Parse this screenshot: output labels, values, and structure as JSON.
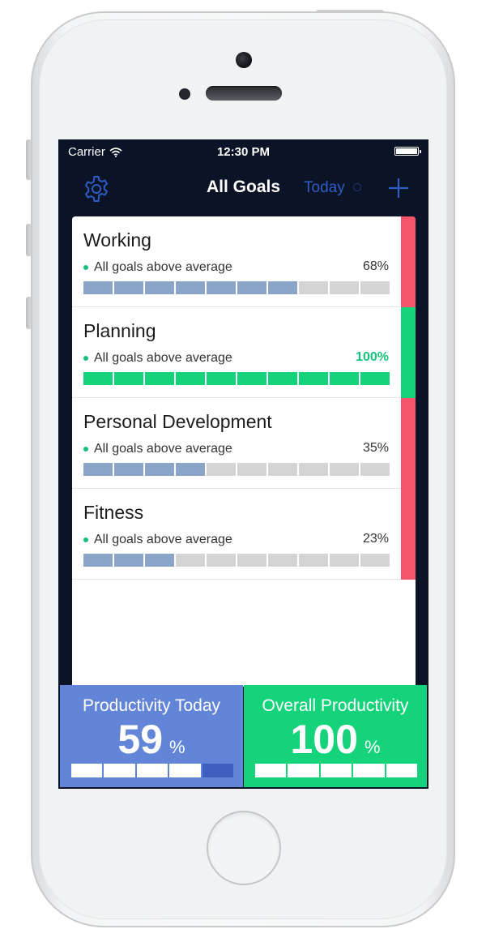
{
  "status_bar": {
    "carrier": "Carrier",
    "time": "12:30 PM"
  },
  "nav": {
    "title": "All Goals",
    "today_label": "Today",
    "settings_icon": "gear-icon",
    "add_icon": "plus-icon"
  },
  "colors": {
    "accent": "#2d5dc4",
    "progress_blue": "#8aa5c7",
    "progress_green": "#14d37b",
    "stripe_red": "#f4536b",
    "stripe_green": "#14d37b",
    "empty": "#d4d4d4"
  },
  "goals": [
    {
      "name": "Working",
      "status": "All goals above average",
      "percent": "68%",
      "filled_segments": 7,
      "total_segments": 10,
      "fill_color": "#8aa5c7",
      "percent_color": "#333333",
      "stripe_color": "#f4536b"
    },
    {
      "name": "Planning",
      "status": "All goals above average",
      "percent": "100%",
      "filled_segments": 10,
      "total_segments": 10,
      "fill_color": "#14d37b",
      "percent_color": "#14c47a",
      "stripe_color": "#14d37b"
    },
    {
      "name": "Personal Development",
      "status": "All goals above average",
      "percent": "35%",
      "filled_segments": 4,
      "total_segments": 10,
      "fill_color": "#8aa5c7",
      "percent_color": "#333333",
      "stripe_color": "#f4536b"
    },
    {
      "name": "Fitness",
      "status": "All goals above average",
      "percent": "23%",
      "filled_segments": 3,
      "total_segments": 10,
      "fill_color": "#8aa5c7",
      "percent_color": "#333333",
      "stripe_color": "#f4536b"
    }
  ],
  "productivity_today": {
    "title": "Productivity Today",
    "value": "59",
    "unit": "%",
    "filled_segments": 4,
    "total_segments": 5
  },
  "overall_productivity": {
    "title": "Overall Productivity",
    "value": "100",
    "unit": "%",
    "filled_segments": 5,
    "total_segments": 5
  }
}
